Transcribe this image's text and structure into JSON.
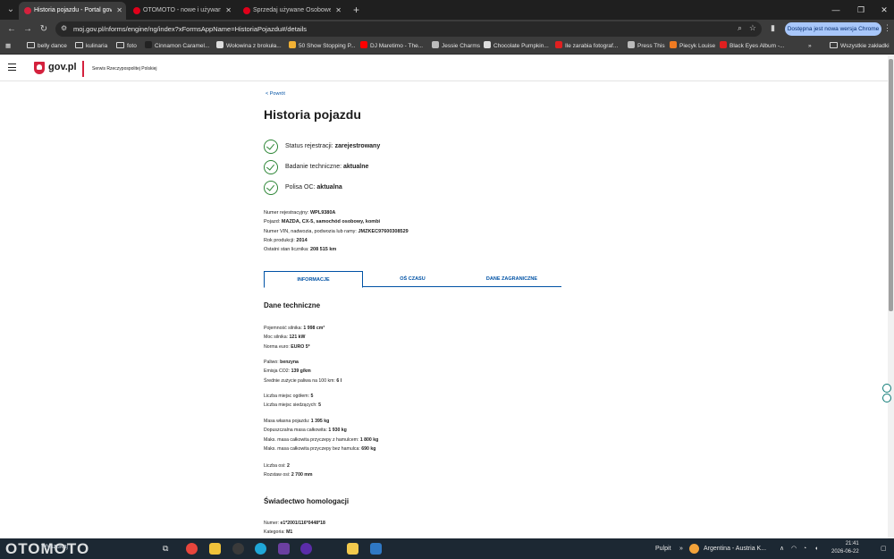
{
  "browser": {
    "tabs": [
      {
        "title": "Historia pojazdu - Portal gov.pl",
        "active": true,
        "favicon_color": "#d4213d"
      },
      {
        "title": "OTOMOTO - nowe i używane sa",
        "active": false,
        "favicon_color": "#e0001a"
      },
      {
        "title": "Sprzedaj używane Osobowe | O",
        "active": false,
        "favicon_color": "#e0001a"
      }
    ],
    "new_tab_icon": "plus-icon",
    "url": "moj.gov.pl/nforms/engine/ng/index?xFormsAppName=HistoriaPojazdu#/details",
    "update_button": "Dostępna jest nowa wersja Chrome",
    "bookmarks": [
      {
        "label": "belly dance",
        "icon": "folder"
      },
      {
        "label": "kulinaria",
        "icon": "folder"
      },
      {
        "label": "foto",
        "icon": "folder"
      },
      {
        "label": "Cinnamon Caramel...",
        "icon": "site",
        "color": "#222"
      },
      {
        "label": "Wołowina z brokuła...",
        "icon": "site",
        "color": "#ddd"
      },
      {
        "label": "50 Show Stopping P...",
        "icon": "site",
        "color": "#f2b134"
      },
      {
        "label": "DJ Maretimo - The...",
        "icon": "site",
        "color": "#ff0000"
      },
      {
        "label": "Jessie Charms",
        "icon": "site",
        "color": "#bbb"
      },
      {
        "label": "Chocolate Pumpkin...",
        "icon": "site",
        "color": "#ddd"
      },
      {
        "label": "Ile zarabia fotograf...",
        "icon": "site",
        "color": "#e02020"
      },
      {
        "label": "Press This",
        "icon": "site",
        "color": "#bbb"
      },
      {
        "label": "Piecyk Louise",
        "icon": "site",
        "color": "#f07b22"
      },
      {
        "label": "Black Eyes Album -...",
        "icon": "site",
        "color": "#e02020"
      }
    ],
    "bookmarks_more": "»",
    "all_bookmarks": "Wszystkie zakładki"
  },
  "site": {
    "logo_text": "gov.pl",
    "logo_subtitle": "Serwis Rzeczypospolitej Polskiej"
  },
  "page": {
    "back_link": "< Powrót",
    "title": "Historia pojazdu",
    "statuses": [
      {
        "label": "Status rejestracji: ",
        "value": "zarejestrowany"
      },
      {
        "label": "Badanie techniczne: ",
        "value": "aktualne"
      },
      {
        "label": "Polisa OC: ",
        "value": "aktualna"
      }
    ],
    "vehicle_info": [
      {
        "label": "Numer rejestracyjny: ",
        "value": "WPL9380A"
      },
      {
        "label": "Pojazd: ",
        "value": "MAZDA, CX-5, samochód osobowy, kombi"
      },
      {
        "label": "Numer VIN, nadwozia, podwozia lub ramy: ",
        "value": "JMZKEC97600308529"
      },
      {
        "label": "Rok produkcji: ",
        "value": "2014"
      },
      {
        "label": "Ostatni stan licznika: ",
        "value": "208 515 km"
      }
    ],
    "tabs": [
      {
        "label": "INFORMACJE",
        "active": true
      },
      {
        "label": "OŚ CZASU",
        "active": false
      },
      {
        "label": "DANE ZAGRANICZNE",
        "active": false
      }
    ],
    "section_technical": "Dane techniczne",
    "technical_groups": [
      [
        {
          "label": "Pojemność silnika: ",
          "value": "1 998 cm³"
        },
        {
          "label": "Moc silnika: ",
          "value": "121 kW"
        },
        {
          "label": "Norma euro: ",
          "value": "EURO 5*"
        }
      ],
      [
        {
          "label": "Paliwo: ",
          "value": "benzyna"
        },
        {
          "label": "Emisja CO2: ",
          "value": "139 g/km"
        },
        {
          "label": "Średnie zużycie paliwa na 100 km: ",
          "value": "6 l"
        }
      ],
      [
        {
          "label": "Liczba miejsc ogółem: ",
          "value": "5"
        },
        {
          "label": "Liczba miejsc siedzących: ",
          "value": "5"
        }
      ],
      [
        {
          "label": "Masa własna pojazdu: ",
          "value": "1 395 kg"
        },
        {
          "label": "Dopuszczalna masa całkowita: ",
          "value": "1 930 kg"
        },
        {
          "label": "Maks. masa całkowita przyczepy z hamulcem: ",
          "value": "1 800 kg"
        },
        {
          "label": "Maks. masa całkowita przyczepy bez hamulca: ",
          "value": "690 kg"
        }
      ],
      [
        {
          "label": "Liczba osi: ",
          "value": "2"
        },
        {
          "label": "Rozstaw osi: ",
          "value": "2 700 mm"
        }
      ]
    ],
    "section_homologation": "Świadectwo homologacji",
    "homologation": [
      {
        "label": "Numer: ",
        "value": "e1*2001/116*0448*18"
      },
      {
        "label": "Kategoria: ",
        "value": "M1"
      }
    ]
  },
  "taskbar": {
    "watermark": "OTOMOTO",
    "search": "Wyszukaj",
    "desktop_label": "Pulpit",
    "weather_label": "Argentina - Austria K...",
    "time": "21:41",
    "date": "2026-06-22"
  }
}
